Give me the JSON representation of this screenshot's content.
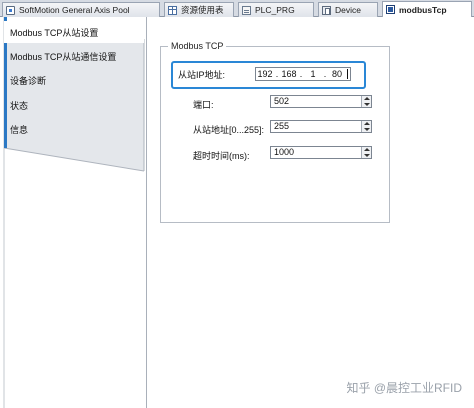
{
  "tabs": [
    {
      "label": "SoftMotion General Axis Pool",
      "icon": "motion-pool-icon",
      "active": false
    },
    {
      "label": "资源使用表",
      "icon": "table-icon",
      "active": false
    },
    {
      "label": "PLC_PRG",
      "icon": "program-icon",
      "active": false
    },
    {
      "label": "Device",
      "icon": "device-icon",
      "active": false
    },
    {
      "label": "modbusTcp",
      "icon": "modbus-icon",
      "active": true
    }
  ],
  "nav": {
    "items": [
      {
        "label": "Modbus TCP从站设置",
        "selected": true
      },
      {
        "label": "Modbus TCP从站通信设置",
        "selected": false
      },
      {
        "label": "设备诊断",
        "selected": false
      },
      {
        "label": "状态",
        "selected": false
      },
      {
        "label": "信息",
        "selected": false
      }
    ],
    "accent": "#2b78c4"
  },
  "group": {
    "title": "Modbus TCP",
    "ip": {
      "label": "从站IP地址:",
      "octets": [
        "192",
        "168",
        "1",
        "80"
      ],
      "highlight_color": "#2a87d6"
    },
    "fields": [
      {
        "label": "端口:",
        "value": "502"
      },
      {
        "label": "从站地址[0...255]:",
        "value": "255"
      },
      {
        "label": "超时时间(ms):",
        "value": "1000"
      }
    ]
  },
  "watermark": {
    "text": "知乎 @晨控工业RFID"
  }
}
